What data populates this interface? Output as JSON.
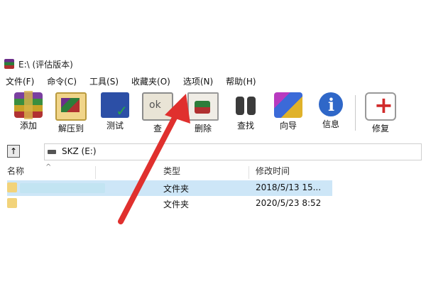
{
  "window": {
    "title": "E:\\ (评估版本)"
  },
  "menu": [
    "文件(F)",
    "命令(C)",
    "工具(S)",
    "收藏夹(O)",
    "选项(N)",
    "帮助(H)"
  ],
  "toolbar": [
    {
      "label": "添加",
      "icon": "add-archive-icon"
    },
    {
      "label": "解压到",
      "icon": "extract-icon"
    },
    {
      "label": "测试",
      "icon": "test-icon"
    },
    {
      "label": "查",
      "icon": "view-icon"
    },
    {
      "label": "删除",
      "icon": "delete-icon"
    },
    {
      "label": "查找",
      "icon": "find-icon"
    },
    {
      "label": "向导",
      "icon": "wizard-icon"
    },
    {
      "label": "信息",
      "icon": "info-icon"
    },
    {
      "label": "修复",
      "icon": "repair-icon"
    }
  ],
  "address": {
    "path": "SKZ (E:)"
  },
  "list": {
    "headers": {
      "name": "名称",
      "type": "类型",
      "modified": "修改时间"
    },
    "rows": [
      {
        "type": "文件夹",
        "modified": "2018/5/13 15...",
        "selected": true
      },
      {
        "type": "文件夹",
        "modified": "2020/5/23 8:52",
        "selected": false
      }
    ]
  },
  "colors": {
    "selection": "#cde6f7",
    "annotation_arrow": "#e0302e"
  }
}
